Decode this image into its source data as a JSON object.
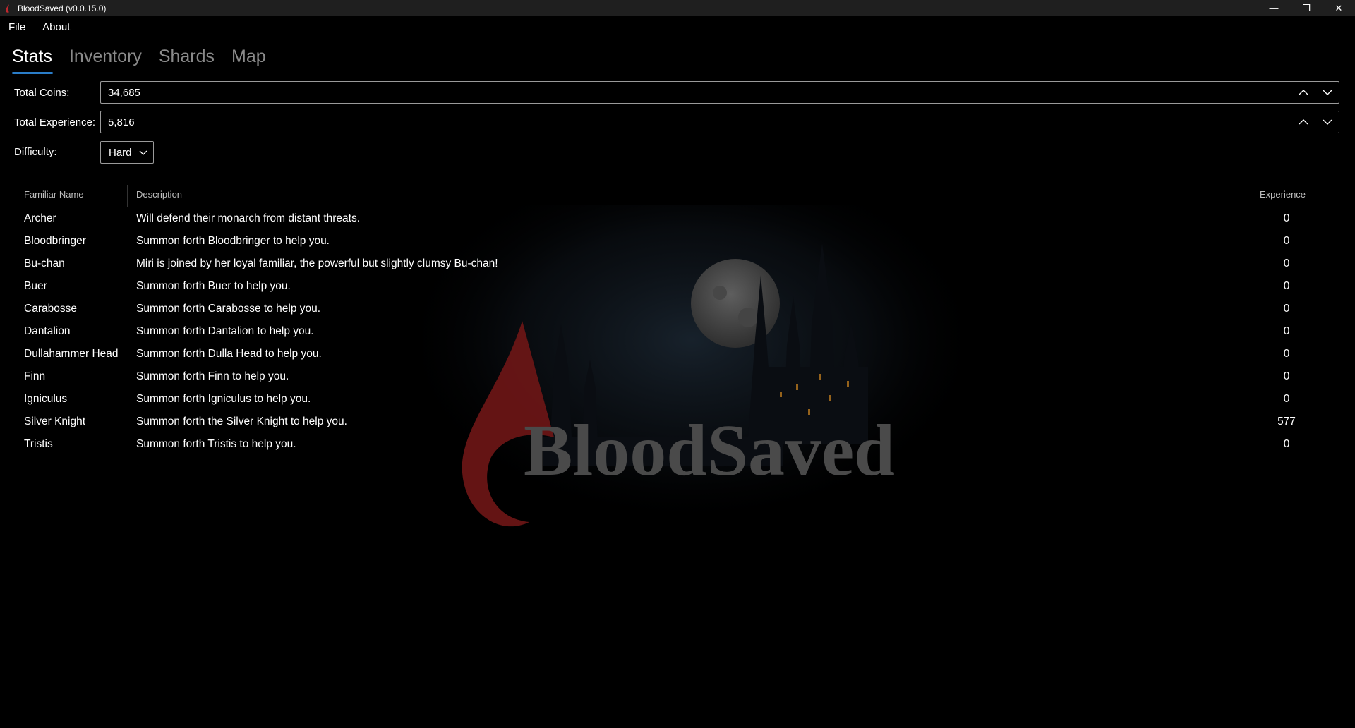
{
  "window": {
    "title": "BloodSaved (v0.0.15.0)",
    "controls": {
      "minimize": "—",
      "restore": "❐",
      "close": "✕"
    }
  },
  "menu": {
    "file": "File",
    "about": "About"
  },
  "tabs": [
    "Stats",
    "Inventory",
    "Shards",
    "Map"
  ],
  "active_tab": "Stats",
  "stats": {
    "coins_label": "Total Coins:",
    "coins_value": "34,685",
    "exp_label": "Total Experience:",
    "exp_value": "5,816",
    "difficulty_label": "Difficulty:",
    "difficulty_value": "Hard"
  },
  "familiars": {
    "columns": {
      "name": "Familiar Name",
      "description": "Description",
      "experience": "Experience"
    },
    "rows": [
      {
        "name": "Archer",
        "description": "Will defend their monarch from distant threats.",
        "experience": "0"
      },
      {
        "name": "Bloodbringer",
        "description": "Summon forth Bloodbringer to help you.",
        "experience": "0"
      },
      {
        "name": "Bu-chan",
        "description": "Miri is joined by her loyal familiar, the powerful but slightly clumsy Bu-chan!",
        "experience": "0"
      },
      {
        "name": "Buer",
        "description": "Summon forth Buer to help you.",
        "experience": "0"
      },
      {
        "name": "Carabosse",
        "description": "Summon forth Carabosse to help you.",
        "experience": "0"
      },
      {
        "name": "Dantalion",
        "description": "Summon forth Dantalion to help you.",
        "experience": "0"
      },
      {
        "name": "Dullahammer Head",
        "description": "Summon forth Dulla Head to help you.",
        "experience": "0"
      },
      {
        "name": "Finn",
        "description": "Summon forth Finn to help you.",
        "experience": "0"
      },
      {
        "name": "Igniculus",
        "description": "Summon forth Igniculus to help you.",
        "experience": "0"
      },
      {
        "name": "Silver Knight",
        "description": "Summon forth the Silver Knight to help you.",
        "experience": "577"
      },
      {
        "name": "Tristis",
        "description": "Summon forth Tristis to help you.",
        "experience": "0"
      }
    ]
  },
  "background": {
    "logo_text": "BloodSaved",
    "icons": [
      "blood-drop-logo",
      "moon",
      "castle"
    ]
  },
  "colors": {
    "accent": "#2a7dc9",
    "blood": "#8b1616",
    "background": "#000000",
    "titlebar": "#1f1f1f"
  }
}
